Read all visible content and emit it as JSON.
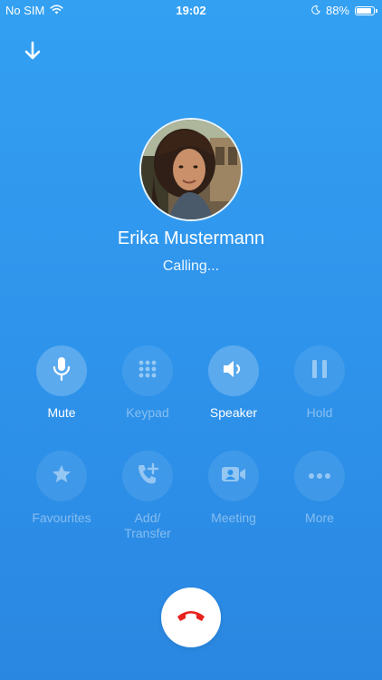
{
  "status_bar": {
    "carrier": "No SIM",
    "time": "19:02",
    "battery_percent": "88%",
    "battery_level": 0.88,
    "icons": [
      "wifi-icon",
      "moon-icon",
      "battery-icon"
    ]
  },
  "call": {
    "caller_name": "Erika Mustermann",
    "status": "Calling..."
  },
  "actions": {
    "mute": {
      "label": "Mute",
      "icon": "microphone-icon",
      "active": true
    },
    "keypad": {
      "label": "Keypad",
      "icon": "keypad-icon",
      "active": false
    },
    "speaker": {
      "label": "Speaker",
      "icon": "speaker-icon",
      "active": true
    },
    "hold": {
      "label": "Hold",
      "icon": "pause-icon",
      "active": false
    },
    "favourites": {
      "label": "Favourites",
      "icon": "star-icon",
      "active": false
    },
    "add_transfer": {
      "label_line1": "Add/",
      "label_line2": "Transfer",
      "icon": "add-call-icon",
      "active": false
    },
    "meeting": {
      "label": "Meeting",
      "icon": "video-meeting-icon",
      "active": false
    },
    "more": {
      "label": "More",
      "icon": "more-dots-icon",
      "active": false
    }
  },
  "colors": {
    "background_top": "#33a0f2",
    "background_bottom": "#2a87e1",
    "hangup_icon": "#e8231e",
    "hangup_button": "#ffffff"
  }
}
